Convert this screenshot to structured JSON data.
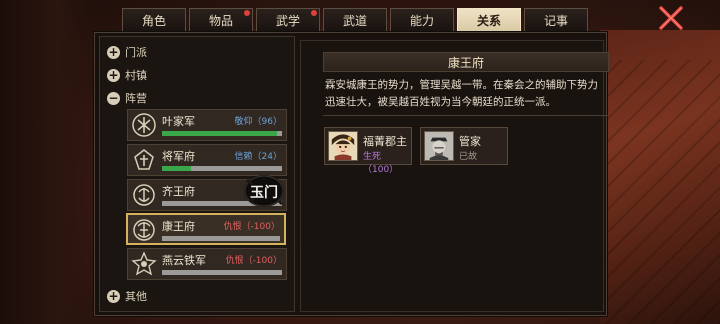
{
  "tabs": [
    {
      "label": "角色",
      "badge": false,
      "active": false
    },
    {
      "label": "物品",
      "badge": true,
      "active": false
    },
    {
      "label": "武学",
      "badge": true,
      "active": false
    },
    {
      "label": "武道",
      "badge": false,
      "active": false
    },
    {
      "label": "能力",
      "badge": false,
      "active": false
    },
    {
      "label": "关系",
      "badge": false,
      "active": true
    },
    {
      "label": "记事",
      "badge": false,
      "active": false
    }
  ],
  "categories": {
    "sect": {
      "icon": "+",
      "label": "门派"
    },
    "village": {
      "icon": "+",
      "label": "村镇"
    },
    "camp": {
      "icon": "−",
      "label": "阵营"
    },
    "other": {
      "icon": "+",
      "label": "其他"
    }
  },
  "factions": [
    {
      "name": "叶家军",
      "relation": "敬仰（96）",
      "value": 0.96,
      "color": "#6fa2d8",
      "bar_color": "#3aa84a",
      "selected": false
    },
    {
      "name": "将军府",
      "relation": "信赖（24）",
      "value": 0.24,
      "color": "#6fa2d8",
      "bar_color": "#3aa84a",
      "selected": false
    },
    {
      "name": "齐王府",
      "relation": "",
      "value": 0,
      "color": "#e06060",
      "bar_color": "#c04040",
      "selected": false
    },
    {
      "name": "康王府",
      "relation": "仇恨（-100）",
      "value": 0,
      "color": "#e06060",
      "bar_color": "#c04040",
      "selected": true
    },
    {
      "name": "燕云铁军",
      "relation": "仇恨（-100）",
      "value": 0,
      "color": "#e06060",
      "bar_color": "#c04040",
      "selected": false
    }
  ],
  "seal_text": "玉门",
  "detail": {
    "title": "康王府",
    "description": "霖安城康王的势力，管理吴越一带。在秦会之的辅助下势力迅速壮大，被吴越百姓视为当今朝廷的正统一派。",
    "members": [
      {
        "name": "福菁郡主",
        "status": "生死（100）",
        "status_color": "#b478d8"
      },
      {
        "name": "管家",
        "status": "已故",
        "status_color": "#a09a90"
      }
    ]
  },
  "colors": {
    "accent_gold": "#d4b25e",
    "enemy_red": "#e06060",
    "ally_blue": "#6fa2d8"
  }
}
